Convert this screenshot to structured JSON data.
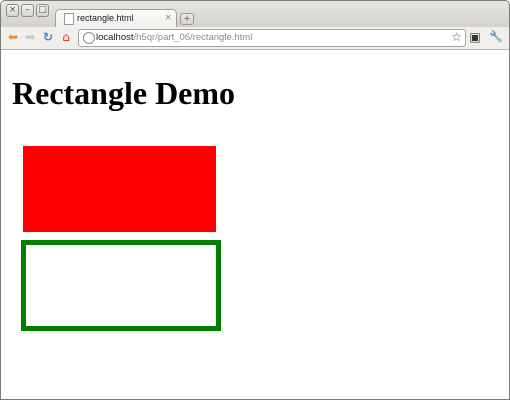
{
  "window": {
    "controls": [
      "×",
      "–",
      "□"
    ]
  },
  "tab": {
    "title": "rectangle.html",
    "close": "×",
    "new_tab": "+"
  },
  "toolbar": {
    "back": "⬅",
    "forward": "➡",
    "reload": "↻",
    "home": "⌂",
    "url_host": "localhost",
    "url_path": "/h5qr/part_06/rectangle.html",
    "bookmark": "☆",
    "page_menu": "▣",
    "wrench": "🔧"
  },
  "page": {
    "heading": "Rectangle Demo",
    "rectangles": [
      {
        "style": "filled",
        "color": "#ff0000"
      },
      {
        "style": "outline",
        "color": "#008000"
      }
    ]
  },
  "colors": {
    "frame": "#d3d1ca",
    "toolbar": "#f0efec",
    "back_arrow": "#e8901e",
    "reload": "#3f7fd5",
    "home": "#c9452e"
  }
}
